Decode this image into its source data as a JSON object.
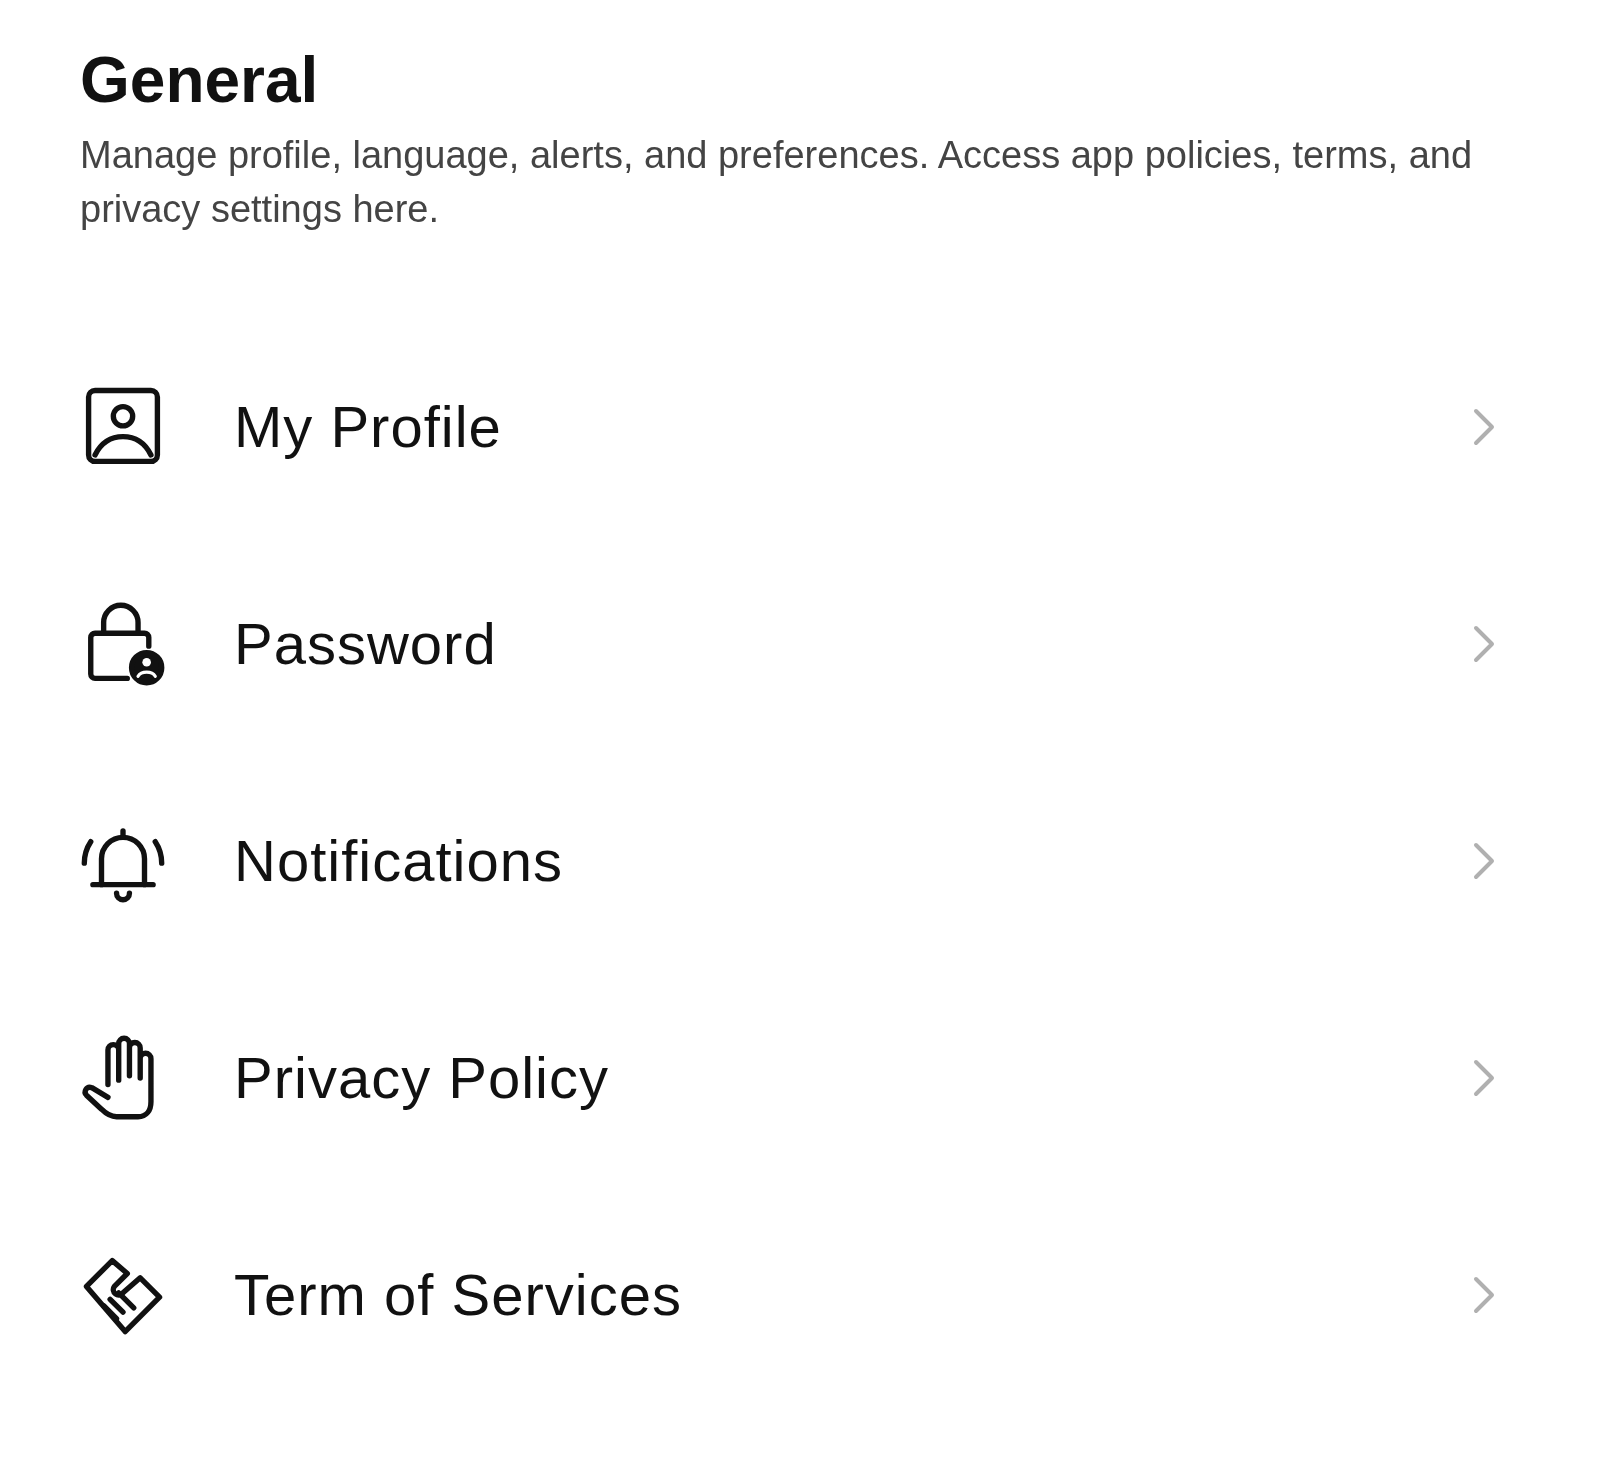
{
  "header": {
    "title": "General",
    "description": "Manage profile, language, alerts, and preferences. Access app policies, terms, and privacy settings here."
  },
  "items": [
    {
      "kind": "profile",
      "label": "My Profile"
    },
    {
      "kind": "lock",
      "label": "Password"
    },
    {
      "kind": "bell",
      "label": "Notifications"
    },
    {
      "kind": "hand",
      "label": "Privacy Policy"
    },
    {
      "kind": "handshake",
      "label": "Term of Services"
    }
  ]
}
